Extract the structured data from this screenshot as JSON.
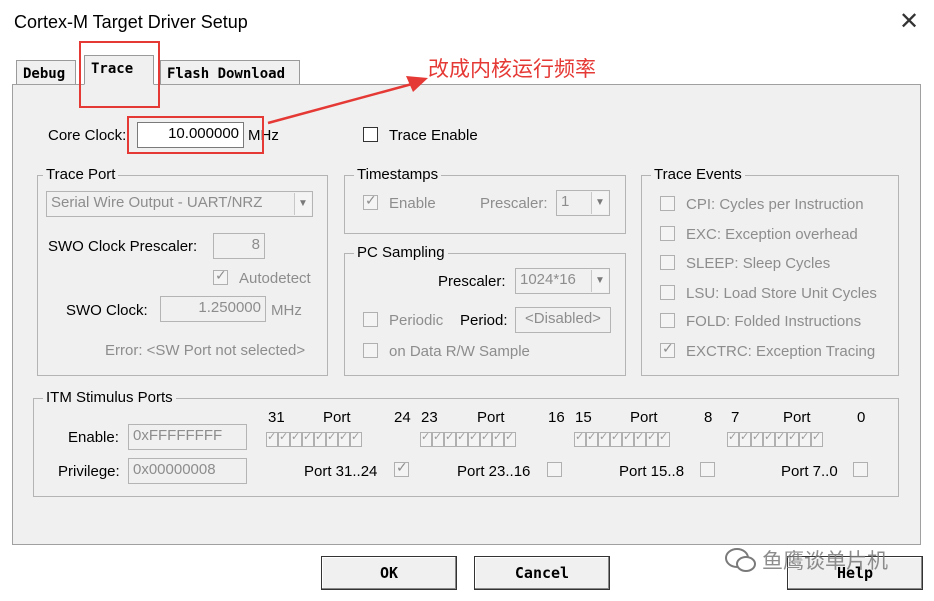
{
  "window": {
    "title": "Cortex-M Target Driver Setup",
    "close_glyph": "✕"
  },
  "tabs": [
    {
      "label": "Debug"
    },
    {
      "label": "Trace"
    },
    {
      "label": "Flash Download"
    }
  ],
  "annotation": {
    "text": "改成内核运行频率",
    "color": "#e53935"
  },
  "core_clock": {
    "label": "Core Clock:",
    "value": "10.000000",
    "unit": "MHz"
  },
  "trace_enable": {
    "label": "Trace Enable",
    "checked": false
  },
  "trace_port": {
    "legend": "Trace Port",
    "port_select": "Serial Wire Output - UART/NRZ",
    "swo_prescaler_label": "SWO Clock Prescaler:",
    "swo_prescaler_value": "8",
    "autodetect_label": "Autodetect",
    "swo_clock_label": "SWO Clock:",
    "swo_clock_value": "1.250000",
    "swo_clock_unit": "MHz",
    "error_text": "Error: <SW Port not selected>"
  },
  "timestamps": {
    "legend": "Timestamps",
    "enable_label": "Enable",
    "prescaler_label": "Prescaler:",
    "prescaler_value": "1"
  },
  "pc_sampling": {
    "legend": "PC Sampling",
    "prescaler_label": "Prescaler:",
    "prescaler_value": "1024*16",
    "periodic_label": "Periodic",
    "period_label": "Period:",
    "period_value": "<Disabled>",
    "on_data_label": "on Data R/W Sample"
  },
  "trace_events": {
    "legend": "Trace Events",
    "items": [
      {
        "label": "CPI: Cycles per Instruction",
        "checked": false
      },
      {
        "label": "EXC: Exception overhead",
        "checked": false
      },
      {
        "label": "SLEEP: Sleep Cycles",
        "checked": false
      },
      {
        "label": "LSU: Load Store Unit Cycles",
        "checked": false
      },
      {
        "label": "FOLD: Folded Instructions",
        "checked": false
      },
      {
        "label": "EXCTRC: Exception Tracing",
        "checked": true
      }
    ]
  },
  "itm": {
    "legend": "ITM Stimulus Ports",
    "enable_label": "Enable:",
    "enable_value": "0xFFFFFFFF",
    "privilege_label": "Privilege:",
    "privilege_value": "0x00000008",
    "groups": [
      {
        "hi": "31",
        "port": "Port",
        "lo": "24",
        "priv_label": "Port 31..24",
        "priv_checked": true
      },
      {
        "hi": "23",
        "port": "Port",
        "lo": "16",
        "priv_label": "Port 23..16",
        "priv_checked": false
      },
      {
        "hi": "15",
        "port": "Port",
        "lo": "8",
        "priv_label": "Port 15..8",
        "priv_checked": false
      },
      {
        "hi": "7",
        "port": "Port",
        "lo": "0",
        "priv_label": "Port 7..0",
        "priv_checked": false
      }
    ]
  },
  "buttons": {
    "ok": "OK",
    "cancel": "Cancel",
    "help": "Help"
  },
  "watermark": "鱼鹰谈单片机",
  "check_glyph": "✓",
  "arrow_glyph": "▼"
}
